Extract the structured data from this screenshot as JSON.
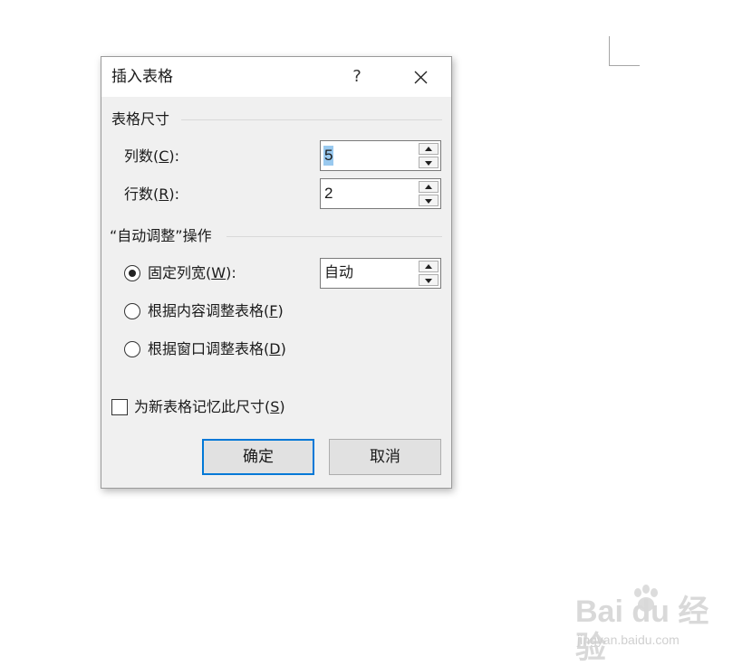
{
  "dialog": {
    "title": "插入表格",
    "help_label": "?"
  },
  "table_size": {
    "group_title": "表格尺寸",
    "columns": {
      "label": "列数(",
      "mnemonic": "C",
      "label_end": "):",
      "value": "5"
    },
    "rows": {
      "label": "行数(",
      "mnemonic": "R",
      "label_end": "):",
      "value": "2"
    }
  },
  "autofit": {
    "group_title": "“自动调整”操作",
    "fixed_width": {
      "label": "固定列宽(",
      "mnemonic": "W",
      "label_end": "):",
      "value": "自动",
      "selected": true
    },
    "fit_contents": {
      "label": "根据内容调整表格(",
      "mnemonic": "F",
      "label_end": ")",
      "selected": false
    },
    "fit_window": {
      "label": "根据窗口调整表格(",
      "mnemonic": "D",
      "label_end": ")",
      "selected": false
    }
  },
  "remember": {
    "label": "为新表格记忆此尺寸(",
    "mnemonic": "S",
    "label_end": ")",
    "checked": false
  },
  "buttons": {
    "ok": "确定",
    "cancel": "取消"
  },
  "watermark": {
    "logo": "Bai du 经验",
    "url": "jingyan.baidu.com"
  },
  "colors": {
    "accent": "#0078d7",
    "dialog_bg": "#f0f0f0",
    "selection": "#99c9ef"
  }
}
